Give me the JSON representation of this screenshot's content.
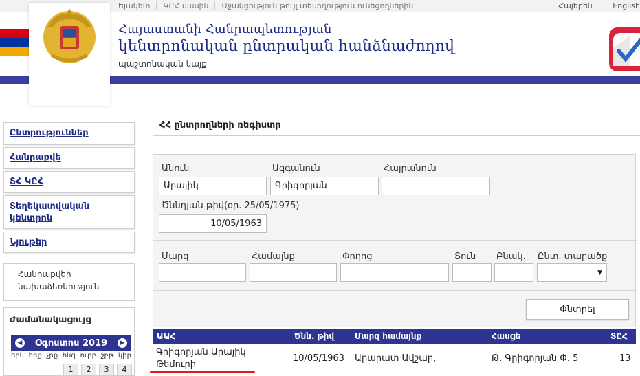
{
  "topnav": [
    "Եյակետ",
    "ԿԸՀ մասին",
    "Աջակցություն թույլ տեսողություն ունեցողներին"
  ],
  "langs": [
    "Հայերեն",
    "English"
  ],
  "header": {
    "line1": "Հայաստանի Հանրապետության",
    "line2": "կենտրոնական ընտրական հանձնաժողով",
    "sub": "պաշտոնական կայք"
  },
  "sidebar": {
    "items": [
      "Ընտրություններ",
      "Հանրաքվե",
      "ՏՀ ԿԸՀ",
      "Տեղեկատվական կենտրոն",
      "Նյութեր"
    ],
    "plain": "Հանրաքվեի նախաձեռնություն",
    "calendar": {
      "title": "Ժամանակացույց",
      "month": "Օգոստոս 2019",
      "days": [
        "երկ",
        "երք",
        "չրք",
        "հնգ",
        "ուրբ",
        "շբթ",
        "կիր"
      ],
      "nums": [
        "1",
        "2",
        "3",
        "4"
      ]
    }
  },
  "main": {
    "title": "ՀՀ ընտրողների ռեգիստր",
    "labels": {
      "name": "Անուն",
      "surname": "Ազգանուն",
      "patronymic": "Հայրանուն",
      "dob": "Ծննդյան թիվ(օր. 25/05/1975)",
      "region": "Մարզ",
      "community": "Համայնք",
      "street": "Փողոց",
      "house": "Տուն",
      "apt": "Բնակ.",
      "district": "Ընտ. տարածք"
    },
    "values": {
      "name": "Արայիկ",
      "surname": "Գրիգորյան",
      "patronymic": "",
      "dob": "10/05/1963"
    },
    "search_label": "Փնտրել"
  },
  "table": {
    "headers": [
      "ԱԱՀ",
      "Ծնն. թիվ",
      "Մարզ համայնք",
      "Հասցե",
      "ՏԸՀ"
    ],
    "row": {
      "name_line1": "Գրիգորյան Արայիկ",
      "name_line2": "Թեմուրի",
      "dob": "10/05/1963",
      "region": "Արարատ Ավշար,",
      "address": "Թ. Գրիգորյան Փ. 5",
      "commission": "13"
    }
  }
}
